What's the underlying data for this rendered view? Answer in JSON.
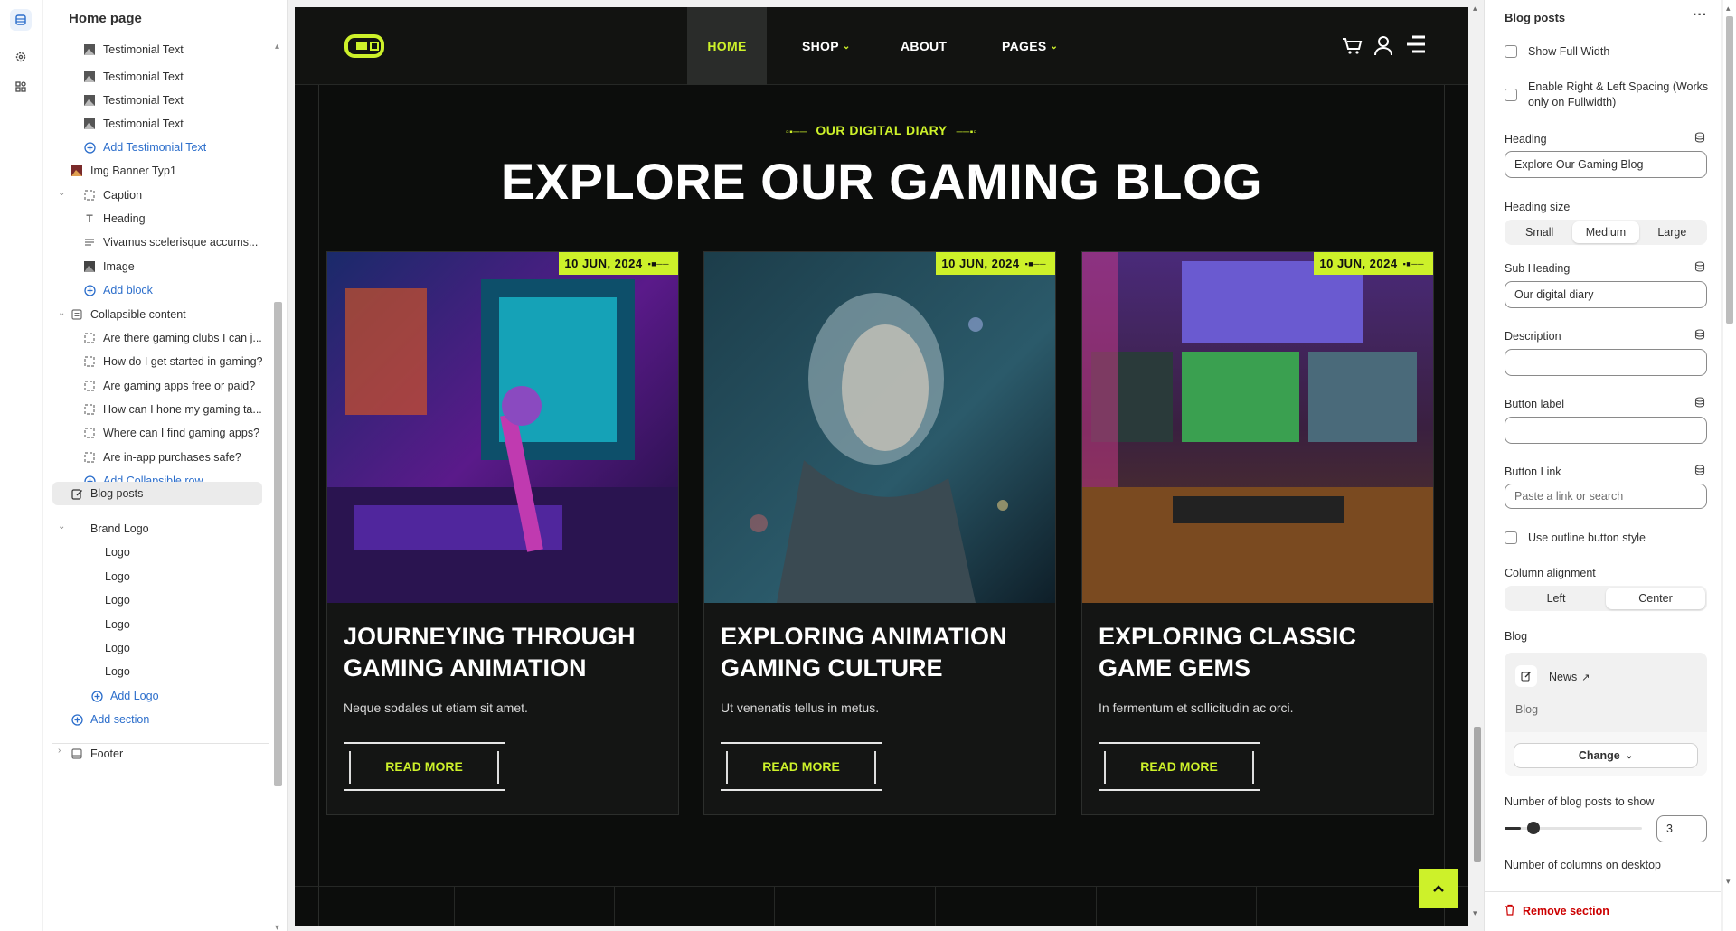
{
  "left_panel": {
    "title": "Home page",
    "items": [
      {
        "label": "Testimonial Text",
        "kind": "image"
      },
      {
        "label": "Testimonial Text",
        "kind": "image"
      },
      {
        "label": "Testimonial Text",
        "kind": "image"
      },
      {
        "label": "Testimonial Text",
        "kind": "image"
      },
      {
        "label": "Add Testimonial Text",
        "kind": "add"
      },
      {
        "label": "Img Banner Typ1",
        "kind": "section"
      },
      {
        "label": "Caption",
        "kind": "block"
      },
      {
        "label": "Heading",
        "kind": "text"
      },
      {
        "label": "Vivamus scelerisque accums...",
        "kind": "paragraph"
      },
      {
        "label": "Image",
        "kind": "image"
      },
      {
        "label": "Add block",
        "kind": "add"
      },
      {
        "label": "Collapsible content",
        "kind": "section"
      },
      {
        "label": "Are there gaming clubs I can j...",
        "kind": "block"
      },
      {
        "label": "How do I get started in gaming?",
        "kind": "block"
      },
      {
        "label": "Are gaming apps free or paid?",
        "kind": "block"
      },
      {
        "label": "How can I hone my gaming ta...",
        "kind": "block"
      },
      {
        "label": "Where can I find gaming apps?",
        "kind": "block"
      },
      {
        "label": "Are in-app purchases safe?",
        "kind": "block"
      },
      {
        "label": "Add Collapsible row",
        "kind": "add"
      },
      {
        "label": "Blog posts",
        "kind": "section"
      },
      {
        "label": "Brand Logo",
        "kind": "section"
      },
      {
        "label": "Logo",
        "kind": "leaf"
      },
      {
        "label": "Logo",
        "kind": "leaf"
      },
      {
        "label": "Logo",
        "kind": "leaf"
      },
      {
        "label": "Logo",
        "kind": "leaf"
      },
      {
        "label": "Logo",
        "kind": "leaf"
      },
      {
        "label": "Logo",
        "kind": "leaf"
      },
      {
        "label": "Add Logo",
        "kind": "add"
      },
      {
        "label": "Add section",
        "kind": "add"
      },
      {
        "label": "Footer",
        "kind": "section"
      }
    ]
  },
  "preview": {
    "nav": {
      "home": "HOME",
      "shop": "SHOP",
      "about": "ABOUT",
      "pages": "PAGES"
    },
    "subheading": "OUR DIGITAL DIARY",
    "heading": "EXPLORE OUR GAMING BLOG",
    "cards": [
      {
        "date": "10 JUN, 2024",
        "title": "JOURNEYING THROUGH GAMING ANIMATION",
        "desc": "Neque sodales ut etiam sit amet.",
        "button": "READ MORE"
      },
      {
        "date": "10 JUN, 2024",
        "title": "EXPLORING ANIMATION GAMING CULTURE",
        "desc": "Ut venenatis tellus in metus.",
        "button": "READ MORE"
      },
      {
        "date": "10 JUN, 2024",
        "title": "EXPLORING CLASSIC GAME GEMS",
        "desc": "In fermentum et sollicitudin ac orci.",
        "button": "READ MORE"
      }
    ],
    "accent": "#cdf12a"
  },
  "right_panel": {
    "title": "Blog posts",
    "show_full_width": "Show Full Width",
    "enable_spacing": "Enable Right & Left Spacing (Works only on Fullwidth)",
    "heading_label": "Heading",
    "heading_value": "Explore Our Gaming Blog",
    "heading_size_label": "Heading size",
    "heading_sizes": [
      "Small",
      "Medium",
      "Large"
    ],
    "heading_size_selected": "Medium",
    "sub_heading_label": "Sub Heading",
    "sub_heading_value": "Our digital diary",
    "description_label": "Description",
    "description_value": "",
    "button_label_label": "Button label",
    "button_label_value": "",
    "button_link_label": "Button Link",
    "button_link_placeholder": "Paste a link or search",
    "outline_label": "Use outline button style",
    "column_alignment_label": "Column alignment",
    "alignments": [
      "Left",
      "Center"
    ],
    "alignment_selected": "Center",
    "blog_label": "Blog",
    "blog_name": "News",
    "blog_type": "Blog",
    "change_label": "Change",
    "num_posts_label": "Number of blog posts to show",
    "num_posts_value": "3",
    "num_columns_label": "Number of columns on desktop",
    "remove_label": "Remove section"
  }
}
